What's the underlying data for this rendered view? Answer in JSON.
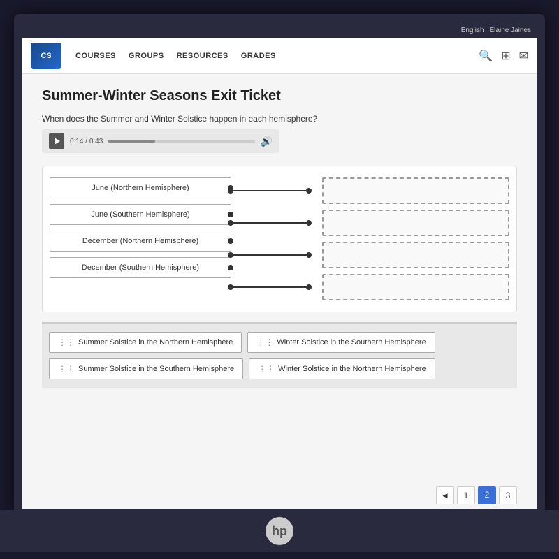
{
  "topbar": {
    "lang": "English",
    "user": "Elaine Jaines"
  },
  "nav": {
    "logo": "CS",
    "links": [
      "COURSES",
      "GROUPS",
      "RESOURCES",
      "GRADES"
    ]
  },
  "page": {
    "title": "Summer-Winter Seasons Exit Ticket",
    "question": "When does the Summer and Winter Solstice happen in each hemisphere?",
    "audio": {
      "current": "0:14",
      "total": "0:43"
    },
    "match_items": [
      "June (Northern Hemisphere)",
      "June (Southern Hemisphere)",
      "December (Northern Hemisphere)",
      "December (Southern Hemisphere)"
    ],
    "drag_items": [
      "Summer Solstice in the Northern Hemisphere",
      "Winter Solstice in the Southern Hemisphere",
      "Summer Solstice in the Southern Hemisphere",
      "Winter Solstice in the Northern Hemisphere"
    ],
    "drag_handle_icon": "⋮⋮"
  },
  "pagination": {
    "prev_label": "◄",
    "pages": [
      "1",
      "2",
      "3"
    ],
    "active_page": 2
  }
}
